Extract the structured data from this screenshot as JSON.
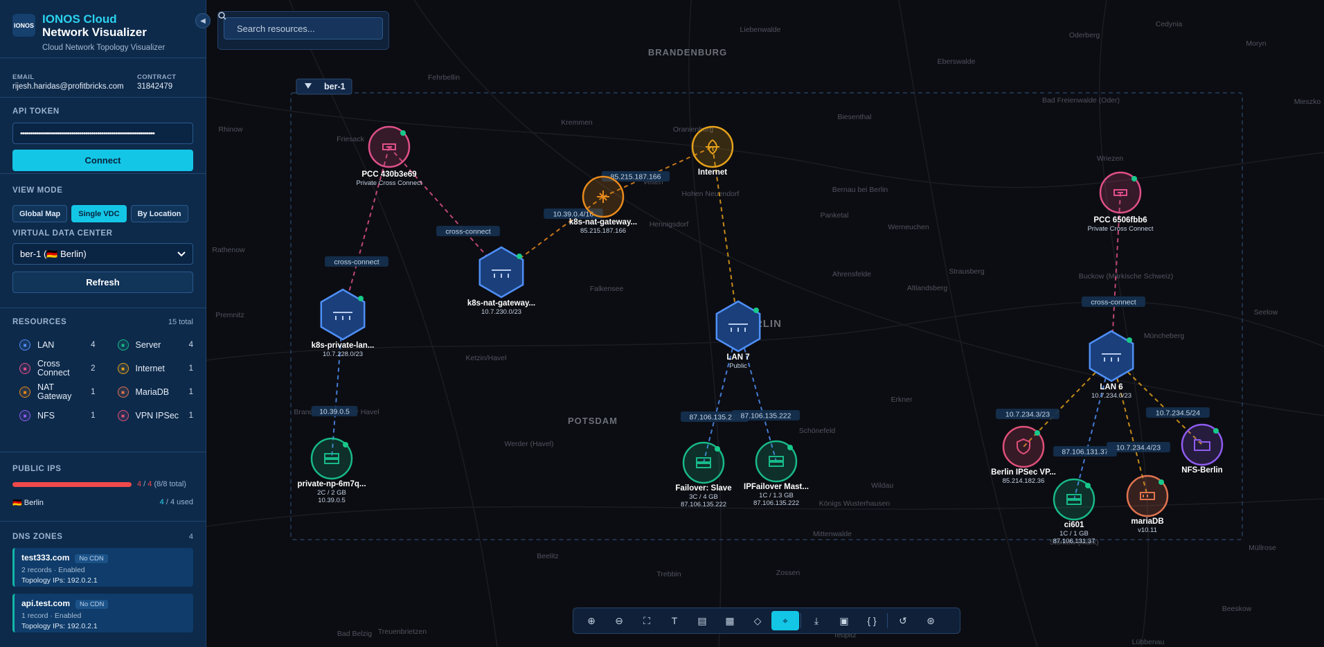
{
  "brand": {
    "logo": "IONOS",
    "line1": "IONOS Cloud",
    "line2": "Network Visualizer",
    "tagline": "Cloud Network Topology Visualizer",
    "collapse_icon": "chevron-left-icon"
  },
  "account": {
    "email_label": "EMAIL",
    "email": "rijesh.haridas@profitbricks.com",
    "contract_label": "CONTRACT",
    "contract": "31842479"
  },
  "token": {
    "label": "API TOKEN",
    "value": "••••••••••••••••••••••••••••••••••••••••••••••••••••••••••••••••••••",
    "connect": "Connect"
  },
  "view": {
    "label": "VIEW MODE",
    "modes": [
      "Global Map",
      "Single VDC",
      "By Location"
    ],
    "active": "Single VDC",
    "vdc_label": "VIRTUAL DATA CENTER",
    "vdc_selected": "ber-1 (🇩🇪 Berlin)",
    "refresh": "Refresh"
  },
  "resources": {
    "label": "RESOURCES",
    "total": "15 total",
    "items": [
      {
        "name": "LAN",
        "count": "4",
        "color": "#4f8ff7",
        "icon": "lan-icon"
      },
      {
        "name": "Server",
        "count": "4",
        "color": "#18b98a",
        "icon": "server-icon"
      },
      {
        "name": "Cross Connect",
        "count": "2",
        "color": "#e0508a",
        "icon": "cross-connect-icon"
      },
      {
        "name": "Internet",
        "count": "1",
        "color": "#e6a21a",
        "icon": "globe-icon"
      },
      {
        "name": "NAT Gateway",
        "count": "1",
        "color": "#e88a1c",
        "icon": "nat-gateway-icon"
      },
      {
        "name": "MariaDB",
        "count": "1",
        "color": "#e0744f",
        "icon": "database-icon"
      },
      {
        "name": "NFS",
        "count": "1",
        "color": "#8f5cf0",
        "icon": "nfs-icon"
      },
      {
        "name": "VPN IPSec",
        "count": "1",
        "color": "#e0507a",
        "icon": "shield-icon"
      }
    ]
  },
  "public_ips": {
    "label": "PUBLIC IPS",
    "used": "4",
    "total": "4",
    "summary": "(8/8 total)",
    "fraction": 1.0,
    "location": "🇩🇪 Berlin",
    "loc_used": "4",
    "loc_total": "4",
    "loc_suffix": "used"
  },
  "dns": {
    "label": "DNS ZONES",
    "count": "4",
    "zones": [
      {
        "name": "test333.com",
        "tag": "No CDN",
        "info": "2 records · Enabled",
        "ips": "Topology IPs: 192.0.2.1"
      },
      {
        "name": "api.test.com",
        "tag": "No CDN",
        "info": "1 record · Enabled",
        "ips": "Topology IPs: 192.0.2.1"
      }
    ]
  },
  "search": {
    "placeholder": "Search resources...",
    "icon": "search-icon"
  },
  "map": {
    "region_label": "ber-1",
    "place_labels": [
      "BRANDENBURG",
      "POTSDAM",
      "BERLIN",
      "Liebenwalde",
      "Eberswalde",
      "Oderberg",
      "Cedynia",
      "Moryn",
      "Fehrbellin",
      "Kremmen",
      "Oranienburg",
      "Biesenthal",
      "Bad Freienwalde (Oder)",
      "Mieszko",
      "Rhinow",
      "Friesack",
      "Velten",
      "Hohen Neuendorf",
      "Bernau bei Berlin",
      "Wriezen",
      "Hennigsdorf",
      "Panketal",
      "Werneuchen",
      "Rathenow",
      "Falkensee",
      "Ahrensfelde",
      "Strausberg",
      "Altlandsberg",
      "Buckow (Märkische Schweiz)",
      "Premnitz",
      "Ketzin/Havel",
      "Müncheberg",
      "Seelow",
      "Brandenburg an der Havel",
      "Erkner",
      "Werder (Havel)",
      "Schönefeld",
      "Königs Wusterhausen",
      "Wildau",
      "Beelitz",
      "Mittenwalde",
      "Storkow (Mark)",
      "Müllrose",
      "Treuenbrietzen",
      "Trebbin",
      "Zossen",
      "Bad Belzig",
      "Teupitz",
      "Beeskow",
      "Lübbenau"
    ],
    "nodes": [
      {
        "id": "pcc1",
        "name": "PCC 430b3e69",
        "sub": "Private Cross Connect",
        "type": "cc"
      },
      {
        "id": "nat",
        "name": "k8s-nat-gateway...",
        "sub": "85.215.187.166",
        "type": "nat"
      },
      {
        "id": "inet",
        "name": "Internet",
        "sub": "",
        "type": "internet"
      },
      {
        "id": "pcc2",
        "name": "PCC 6506fbb6",
        "sub": "Private Cross Connect",
        "type": "cc"
      },
      {
        "id": "lanpriv",
        "name": "k8s-private-lan...",
        "sub": "10.7.228.0/23",
        "type": "lan"
      },
      {
        "id": "lannat",
        "name": "k8s-nat-gateway...",
        "sub": "10.7.230.0/23",
        "type": "lan"
      },
      {
        "id": "lan7",
        "name": "LAN 7",
        "sub": "Public",
        "type": "lan"
      },
      {
        "id": "lan6",
        "name": "LAN 6",
        "sub": "10.7.234.0/23",
        "type": "lan"
      },
      {
        "id": "np",
        "name": "private-np-6m7q...",
        "sub": "2C / 2 GB",
        "sub2": "10.39.0.5",
        "type": "server"
      },
      {
        "id": "slave",
        "name": "Failover: Slave",
        "sub": "3C / 4 GB",
        "sub2": "87.106.135.222",
        "type": "server"
      },
      {
        "id": "master",
        "name": "IPFailover Mast...",
        "sub": "1C / 1.3 GB",
        "sub2": "87.106.135.222",
        "type": "server"
      },
      {
        "id": "vpn",
        "name": "Berlin IPSec VP...",
        "sub": "85.214.182.36",
        "type": "vpn"
      },
      {
        "id": "ci",
        "name": "ci601",
        "sub": "1C / 1 GB",
        "sub2": "87.106.131.37",
        "type": "server"
      },
      {
        "id": "maria",
        "name": "mariaDB",
        "sub": "v10.11",
        "type": "maria"
      },
      {
        "id": "nfs",
        "name": "NFS-Berlin",
        "sub": "",
        "type": "nfs"
      }
    ],
    "edge_labels": [
      "cross-connect",
      "cross-connect",
      "cross-connect",
      "10.39.0.4/16",
      "85.215.187.166",
      "10.39.0.5",
      "87.106.135.222",
      "87.106.135.222",
      "10.7.234.3/23",
      "87.106.131.37",
      "10.7.234.4/23",
      "10.7.234.5/24"
    ]
  },
  "toolbar": [
    {
      "name": "zoom-in-icon",
      "glyph": "⊕"
    },
    {
      "name": "zoom-out-icon",
      "glyph": "⊖"
    },
    {
      "name": "fit-view-icon",
      "glyph": "⛶"
    },
    {
      "name": "text-label-icon",
      "glyph": "T"
    },
    {
      "name": "ip-label-icon",
      "glyph": "▤"
    },
    {
      "name": "server-specs-icon",
      "glyph": "▦"
    },
    {
      "name": "shield-icon",
      "glyph": "◇"
    },
    {
      "name": "location-pin-icon",
      "glyph": "⌖",
      "active": true
    },
    {
      "name": "download-icon",
      "glyph": "⤓"
    },
    {
      "name": "export-image-icon",
      "glyph": "▣"
    },
    {
      "name": "json-icon",
      "glyph": "{ }"
    },
    {
      "name": "reset-icon",
      "glyph": "↺"
    },
    {
      "name": "globe-icon",
      "glyph": "⊛"
    }
  ]
}
